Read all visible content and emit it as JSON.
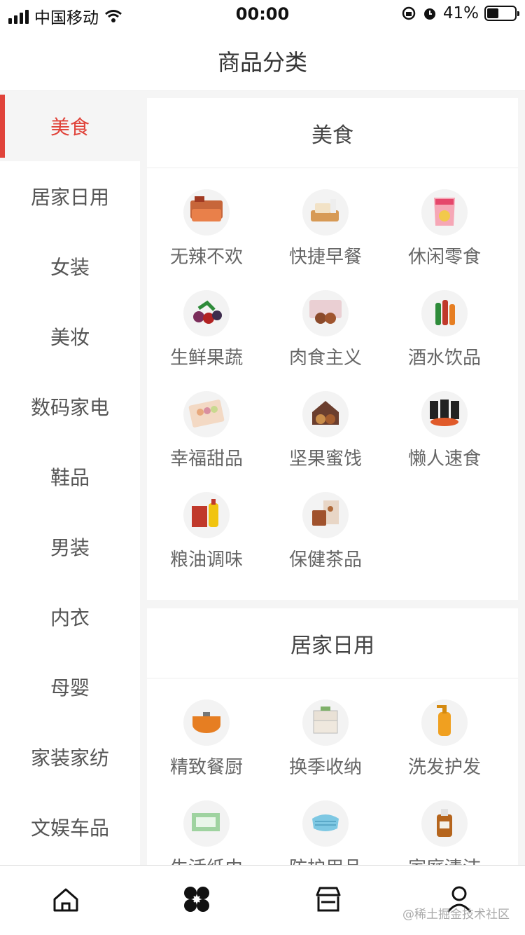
{
  "status": {
    "carrier": "中国移动",
    "time": "00:00",
    "battery": "41%",
    "battery_level": 0.41
  },
  "nav": {
    "title": "商品分类"
  },
  "sidebar": {
    "active_index": 0,
    "items": [
      {
        "label": "美食"
      },
      {
        "label": "居家日用"
      },
      {
        "label": "女装"
      },
      {
        "label": "美妆"
      },
      {
        "label": "数码家电"
      },
      {
        "label": "鞋品"
      },
      {
        "label": "男装"
      },
      {
        "label": "内衣"
      },
      {
        "label": "母婴"
      },
      {
        "label": "家装家纺"
      },
      {
        "label": "文娱车品"
      }
    ]
  },
  "sections": [
    {
      "title": "美食",
      "items": [
        {
          "label": "无辣不欢",
          "icon": "spicy-snack-icon"
        },
        {
          "label": "快捷早餐",
          "icon": "bread-icon"
        },
        {
          "label": "休闲零食",
          "icon": "chips-bag-icon"
        },
        {
          "label": "生鲜果蔬",
          "icon": "fruit-icon"
        },
        {
          "label": "肉食主义",
          "icon": "meat-icon"
        },
        {
          "label": "酒水饮品",
          "icon": "bottles-icon"
        },
        {
          "label": "幸福甜品",
          "icon": "macaron-box-icon"
        },
        {
          "label": "坚果蜜饯",
          "icon": "nuts-icon"
        },
        {
          "label": "懒人速食",
          "icon": "instant-noodle-icon"
        },
        {
          "label": "粮油调味",
          "icon": "oil-rice-icon"
        },
        {
          "label": "保健茶品",
          "icon": "tea-box-icon"
        }
      ]
    },
    {
      "title": "居家日用",
      "items": [
        {
          "label": "精致餐厨",
          "icon": "pot-icon"
        },
        {
          "label": "换季收纳",
          "icon": "storage-box-icon"
        },
        {
          "label": "洗发护发",
          "icon": "shampoo-icon"
        },
        {
          "label": "生活纸巾",
          "icon": "tissue-icon"
        },
        {
          "label": "防护用品",
          "icon": "mask-icon"
        },
        {
          "label": "家庭清洁",
          "icon": "disinfectant-icon"
        }
      ]
    }
  ],
  "tabs": [
    {
      "name": "home",
      "icon": "home-icon"
    },
    {
      "name": "category",
      "icon": "category-icon"
    },
    {
      "name": "shop",
      "icon": "store-icon"
    },
    {
      "name": "profile",
      "icon": "user-icon"
    }
  ],
  "watermark": "@稀土掘金技术社区"
}
